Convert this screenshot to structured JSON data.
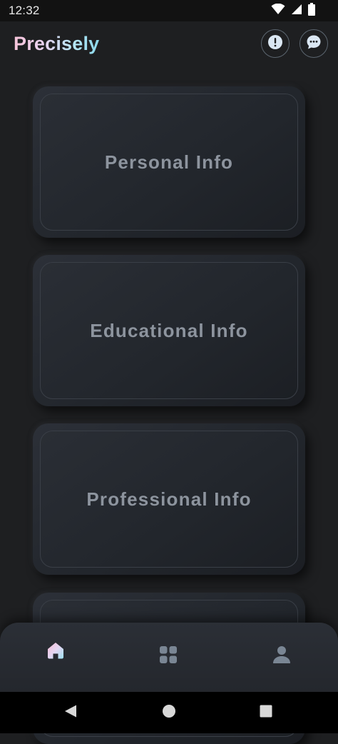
{
  "status_bar": {
    "time": "12:32",
    "icons": [
      "wifi-icon",
      "signal-icon",
      "battery-icon"
    ]
  },
  "header": {
    "title": "Precisely",
    "buttons": [
      {
        "name": "alert-button",
        "icon": "exclamation-icon"
      },
      {
        "name": "chat-button",
        "icon": "chat-bubble-icon"
      }
    ]
  },
  "cards": [
    {
      "label": "Personal Info"
    },
    {
      "label": "Educational Info"
    },
    {
      "label": "Professional Info"
    },
    {
      "label": ""
    }
  ],
  "bottom_nav": {
    "items": [
      {
        "name": "home",
        "icon": "home-icon",
        "active": true
      },
      {
        "name": "grid",
        "icon": "grid-icon",
        "active": false
      },
      {
        "name": "profile",
        "icon": "person-icon",
        "active": false
      }
    ]
  },
  "colors": {
    "background": "#1e1f21",
    "card": "#262a30",
    "card_text": "#8d949e",
    "icon_muted": "#7a8694",
    "title_gradient": [
      "#f6c3d9",
      "#b6e6f5",
      "#8ad7ea"
    ]
  }
}
